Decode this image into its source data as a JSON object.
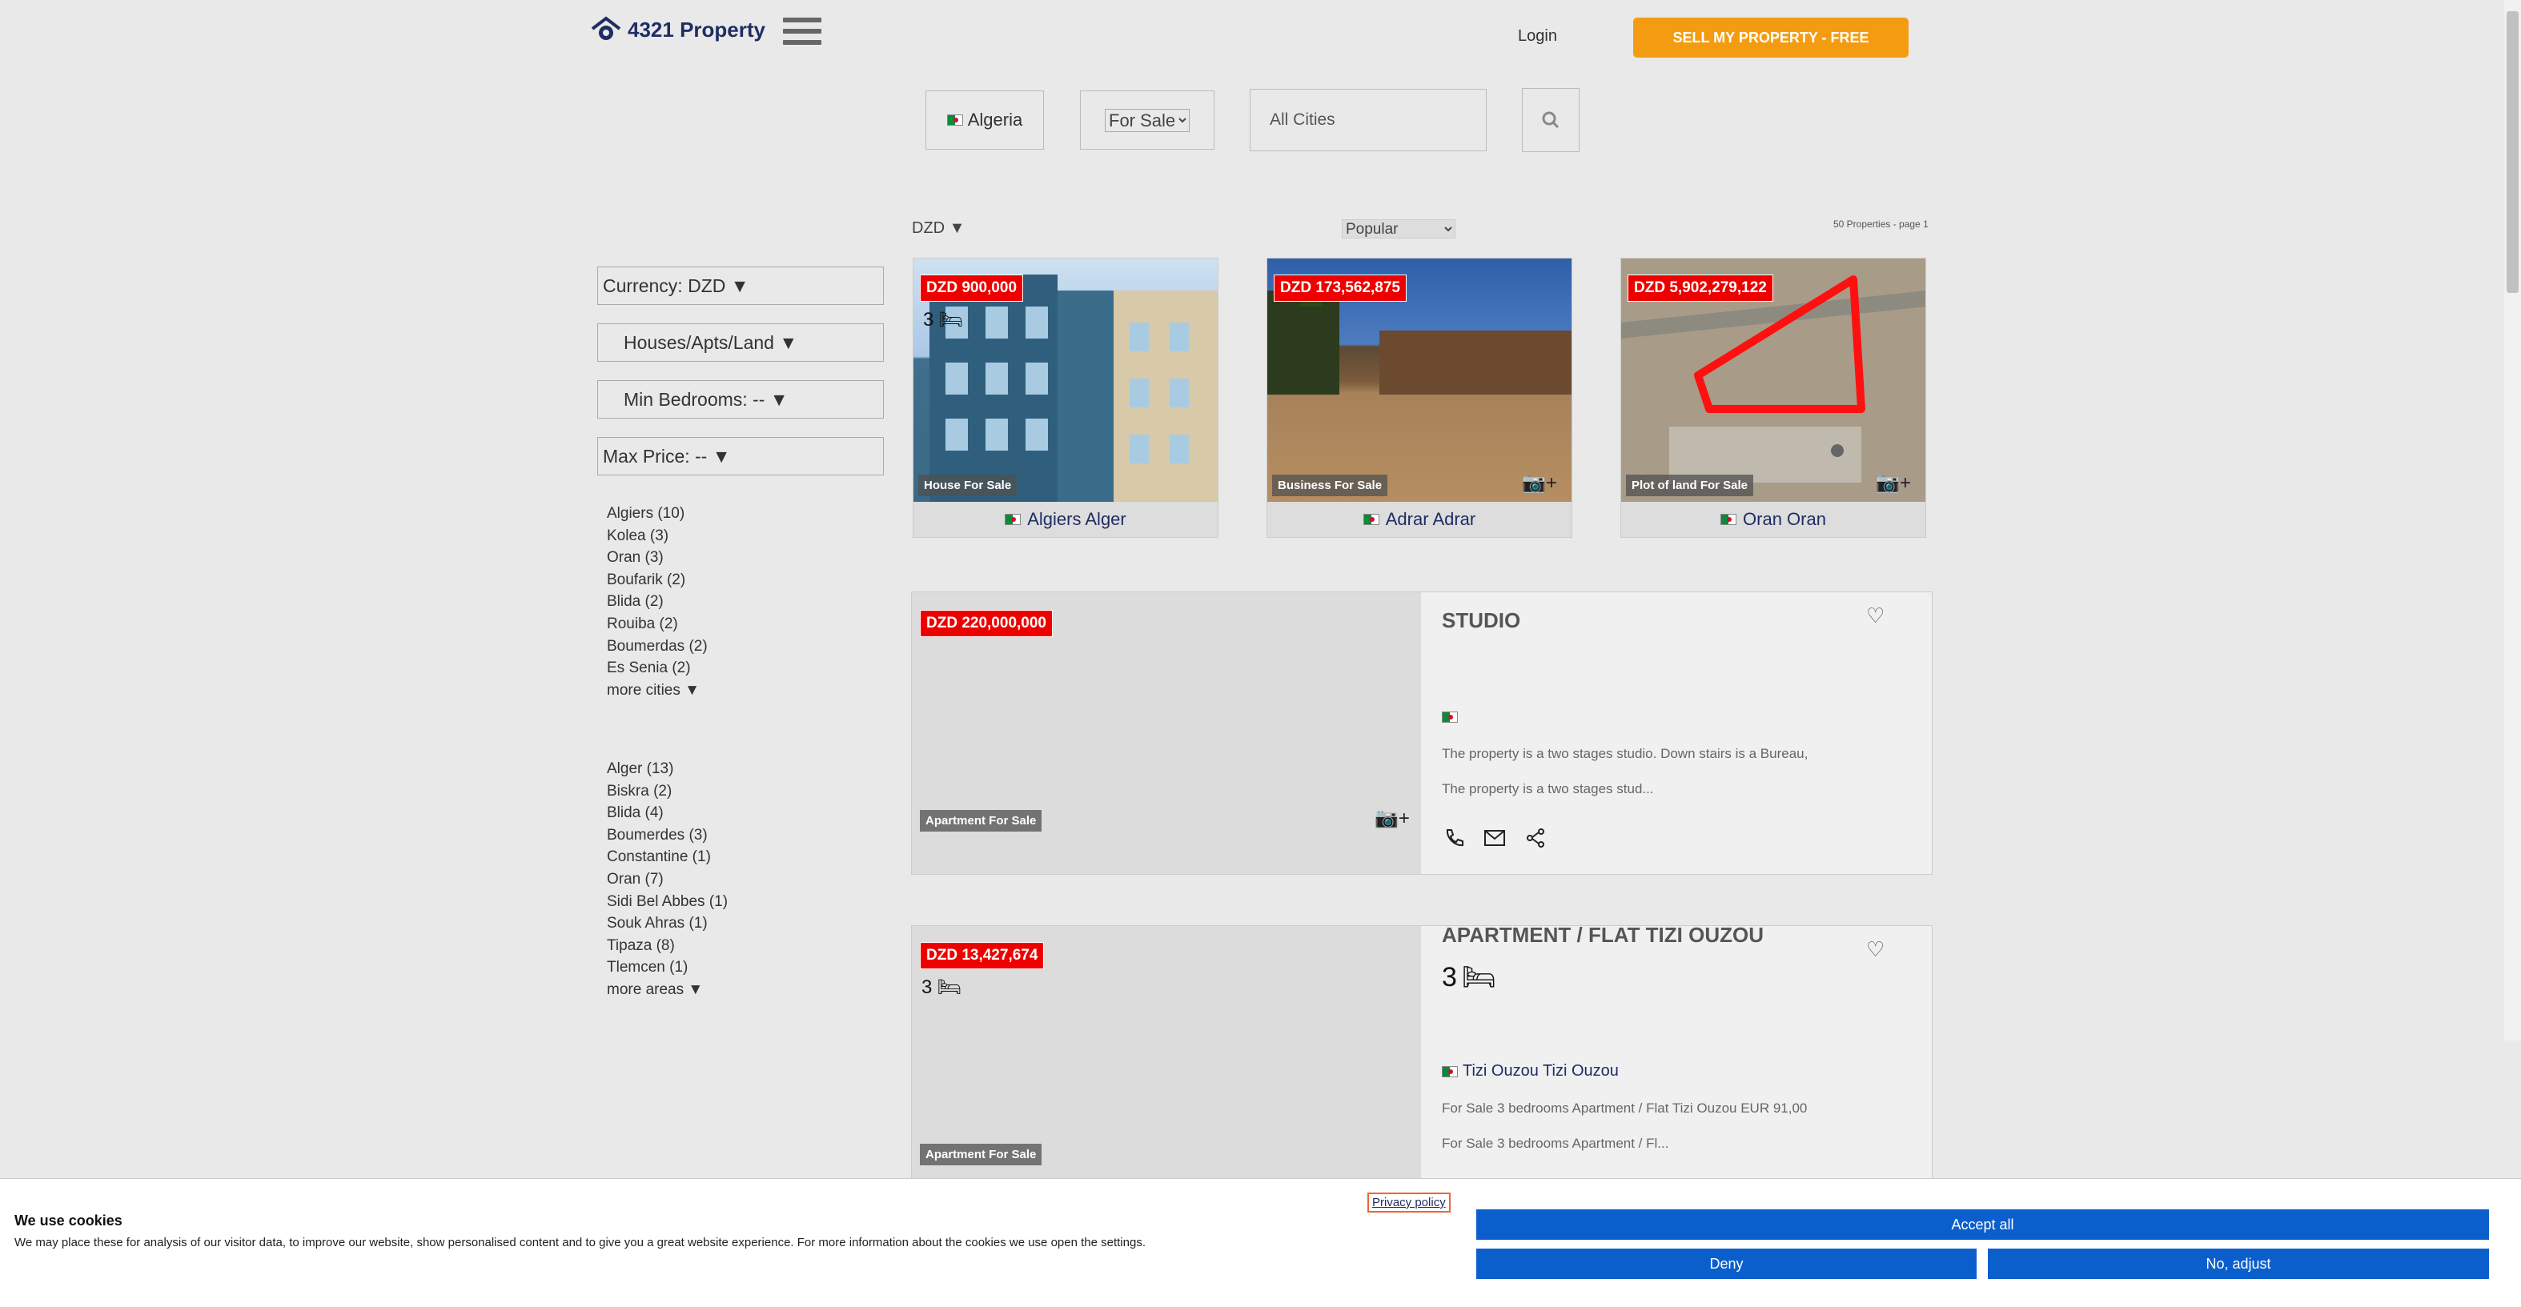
{
  "header": {
    "logo_text": "4321 Property",
    "login_label": "Login",
    "sell_label": "SELL MY PROPERTY - FREE"
  },
  "search": {
    "country": "Algeria",
    "purpose_options": [
      "For Sale"
    ],
    "purpose_selected": "For Sale",
    "city_placeholder": "All Cities"
  },
  "sidebar": {
    "currency": "Currency: DZD ▼",
    "type": "Houses/Apts/Land ▼",
    "min_bedrooms": "Min Bedrooms: -- ▼",
    "max_price": "Max Price: -- ▼",
    "cities": [
      "Algiers (10)",
      "Kolea (3)",
      "Oran (3)",
      "Boufarik (2)",
      "Blida (2)",
      "Rouiba (2)",
      "Boumerdas (2)",
      "Es Senia (2)"
    ],
    "more_cities": "more cities ▼",
    "areas": [
      "Alger (13)",
      "Biskra (2)",
      "Blida (4)",
      "Boumerdes (3)",
      "Constantine (1)",
      "Oran (7)",
      "Sidi Bel Abbes (1)",
      "Souk Ahras (1)",
      "Tipaza (8)",
      "Tlemcen (1)"
    ],
    "more_areas": "more areas ▼"
  },
  "results": {
    "currency": "DZD ▼",
    "sort_selected": "Popular",
    "count": "50 Properties - page 1"
  },
  "featured": [
    {
      "price": "DZD 900,000",
      "beds": "3",
      "type": "House For Sale",
      "location": "Algiers Alger"
    },
    {
      "price": "DZD 173,562,875",
      "type": "Business For Sale",
      "location": "Adrar Adrar"
    },
    {
      "price": "DZD 5,902,279,122",
      "type": "Plot of land For Sale",
      "location": "Oran Oran"
    }
  ],
  "listings": [
    {
      "price": "DZD 220,000,000",
      "type": "Apartment For Sale",
      "title": "STUDIO",
      "desc1": "The property is a two stages studio. Down stairs is a Bureau,",
      "desc2": "The property is a two stages stud..."
    },
    {
      "price": "DZD 13,427,674",
      "beds": "3",
      "type": "Apartment For Sale",
      "title": "APARTMENT / FLAT TIZI OUZOU",
      "location": "Tizi Ouzou Tizi Ouzou",
      "desc1": "For Sale 3 bedrooms Apartment / Flat Tizi Ouzou EUR 91,00",
      "desc2": "For Sale 3 bedrooms Apartment / Fl..."
    }
  ],
  "cookies": {
    "title": "We use cookies",
    "text": "We may place these for analysis of our visitor data, to improve our website, show personalised content and to give you a great website experience. For more information about the cookies we use open the settings.",
    "privacy": "Privacy policy",
    "accept": "Accept all",
    "deny": "Deny",
    "adjust": "No, adjust"
  },
  "colors": {
    "accent": "#f39c12",
    "price_badge": "#ee0000",
    "cookie_button": "#0b5fcc",
    "brand": "#1f2d63"
  }
}
